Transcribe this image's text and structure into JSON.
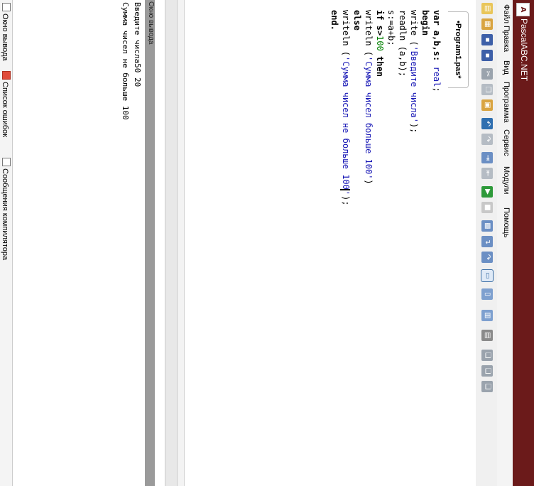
{
  "window": {
    "title": "PascalABC.NET",
    "icon_label": "A"
  },
  "menu": {
    "items": [
      "Файл",
      "Правка",
      "Вид",
      "Программа",
      "Сервис",
      "Модули",
      "Помощь"
    ]
  },
  "toolbar": {
    "buttons": [
      "new-file-icon",
      "open-icon",
      "save-icon",
      "save-all-icon",
      "cut-icon",
      "copy-icon",
      "paste-icon",
      "undo-icon",
      "redo-icon",
      "indent-icon",
      "outdent-icon",
      "run-icon",
      "stop-icon",
      "compile-icon",
      "step-into-icon",
      "step-over-icon",
      "toggle-view-icon",
      "debug-icon",
      "watch-icon",
      "locals-icon",
      "doc-icon-1",
      "doc-icon-2",
      "doc-icon-3"
    ]
  },
  "tabs": {
    "active_label": "•Program1.pas*"
  },
  "code": {
    "line1_a": "var a,b,s: ",
    "line1_b": "real",
    "line1_c": ";",
    "line2": "begin",
    "line3_a": "write (",
    "line3_str": "'Введите числа'",
    "line3_c": ");",
    "line4": "readln (a,b);",
    "line5": "s:=a+b;",
    "line6_a": "if s>",
    "line6_num": "100",
    "line6_c": " then",
    "line7_a": "writeln (",
    "line7_str": "'Сумма чисел больше 100'",
    "line7_c": ")",
    "line8": "else",
    "line9_a": "writeln (",
    "line9_str1": "'Сумма чисел не больше 100",
    "line9_str2": "'",
    "line9_c": ");",
    "line10": "end."
  },
  "output": {
    "header": "Окно вывода",
    "line1": "Введите числа50 20",
    "line2": "Сумма чисел не больше 100"
  },
  "bottom_tabs": {
    "output_window": "Окно вывода",
    "error_list": "Список ошибок",
    "compiler_messages": "Сообщения компилятора"
  },
  "colors": {
    "titlebar": "#6b1a1a",
    "string": "#1414b4",
    "number": "#008000"
  }
}
